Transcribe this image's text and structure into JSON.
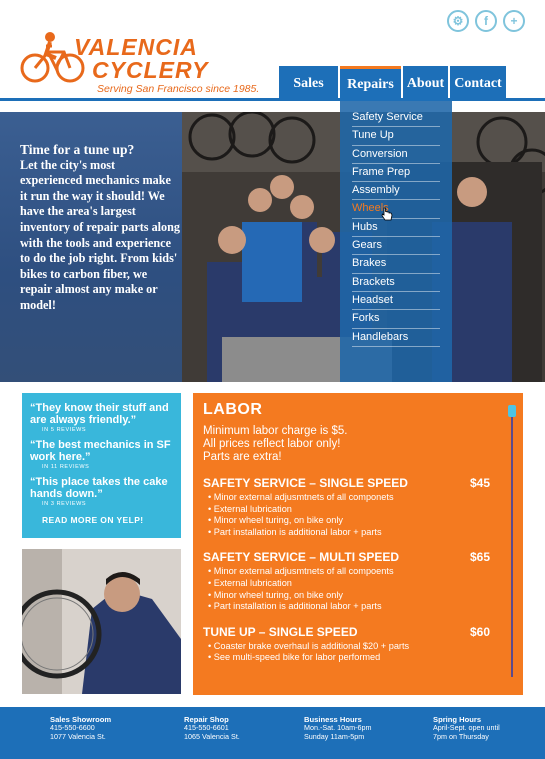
{
  "brand": {
    "name_line1": "VALENCIA",
    "name_line2": "CYCLERY",
    "tagline": "Serving San Francisco since 1985."
  },
  "social": [
    {
      "icon": "gear-icon",
      "glyph": "⚙"
    },
    {
      "icon": "facebook-icon",
      "glyph": "f"
    },
    {
      "icon": "plus-icon",
      "glyph": "+"
    }
  ],
  "nav": {
    "items": [
      "Sales",
      "Repairs",
      "About",
      "Contact"
    ],
    "active": "Repairs"
  },
  "dropdown": {
    "items": [
      "Safety Service",
      "Tune Up",
      "Conversion",
      "Frame Prep",
      "Assembly",
      "Wheels",
      "Hubs",
      "Gears",
      "Brakes",
      "Brackets",
      "Headset",
      "Forks",
      "Handlebars"
    ],
    "hovered": "Wheels"
  },
  "hero": {
    "lead": "Time for a tune up?",
    "body": "Let the city's most experienced mechanics make it run the way it should! We have the area's largest inventory of repair parts along with the tools and experience to do the job right. From kids' bikes to carbon fiber, we repair almost any make or model!"
  },
  "reviews": {
    "items": [
      {
        "quote": "“They know their stuff and are always friendly.”",
        "count": "IN 5 REVIEWS"
      },
      {
        "quote": "“The best mechanics in SF work here.”",
        "count": "IN 11 REVIEWS"
      },
      {
        "quote": "“This place takes the cake hands down.”",
        "count": "IN 3 REVIEWS"
      }
    ],
    "yelp_link": "READ MORE ON YELP!"
  },
  "labor": {
    "title": "LABOR",
    "intro": [
      "Minimum labor charge is $5.",
      "All prices reflect labor only!",
      "Parts are extra!"
    ],
    "services": [
      {
        "name": "SAFETY SERVICE – SINGLE SPEED",
        "price": "$45",
        "items": [
          "Minor external adjusmtnets of all componets",
          "External lubrication",
          "Minor wheel turing, on bike only",
          "Part installation is additional labor + parts"
        ]
      },
      {
        "name": "SAFETY SERVICE – MULTI SPEED",
        "price": "$65",
        "items": [
          "Minor external adjusmtnets of all compoents",
          "External lubrication",
          "Minor wheel turing, on bike only",
          "Part installation is additional labor + parts"
        ]
      },
      {
        "name": "TUNE UP – SINGLE SPEED",
        "price": "$60",
        "items": [
          "Coaster brake overhaul is additional $20 + parts",
          "See multi-speed bike for labor performed"
        ]
      }
    ]
  },
  "footer": {
    "columns": [
      {
        "title": "Sales Showroom",
        "lines": [
          "415-550-6600",
          "1077 Valencia St."
        ]
      },
      {
        "title": "Repair Shop",
        "lines": [
          "415-550-6601",
          "1065 Valencia St."
        ]
      },
      {
        "title": "Business Hours",
        "lines": [
          "Mon.-Sat. 10am-6pm",
          "Sunday 11am-5pm"
        ]
      },
      {
        "title": "Spring Hours",
        "lines": [
          "April-Sept. open until",
          "7pm on Thursday"
        ]
      }
    ]
  },
  "colors": {
    "brand_orange": "#f47a20",
    "nav_blue": "#1d6fb8",
    "review_cyan": "#39b7db"
  }
}
